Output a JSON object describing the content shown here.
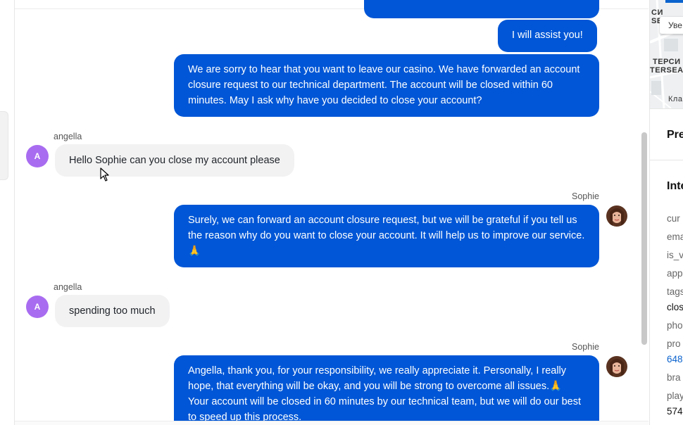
{
  "messages": {
    "m1": {
      "text": "I will assist you!"
    },
    "m2": {
      "text": "We are sorry to hear that you want to leave our casino. We have forwarded an account closure request to our technical department. The account will be closed within 60 minutes. May I ask why have you decided to close your account?"
    },
    "m3": {
      "sender": "angella",
      "avatar": "A",
      "text": "Hello Sophie can you close my account please"
    },
    "m4": {
      "sender": "Sophie",
      "text": "Surely, we can forward an account closure request, but we will be grateful if you tell us the reason why do you want to close your account. It will help us to improve our service.🙏"
    },
    "m5": {
      "sender": "angella",
      "avatar": "A",
      "text": "spending too much"
    },
    "m6": {
      "sender": "Sophie",
      "text": "Angella, thank you, for your responsibility, we really appreciate it. Personally, I really hope, that everything will be okay, and you will be strong to overcome all issues.🙏 Your account will be closed in 60 minutes by our technical team, but we will do our best to speed up this process."
    }
  },
  "right_panel": {
    "map": {
      "zoom_button": "Уве",
      "label1": "СИ",
      "label2": "SE",
      "label3": "ТЕРСИ",
      "label4": "TERSEA",
      "label5": "Кла"
    },
    "section1_title": "Pre",
    "section2_title": "Inte",
    "fields": {
      "k1": "cur",
      "k2": "ema",
      "k3": "is_v",
      "k4": "app",
      "k5": "tags",
      "v5": "clos",
      "k6": "pho",
      "k7": "pro",
      "v7": "648",
      "k8": "bra",
      "k9": "play",
      "v9": "574"
    }
  },
  "colors": {
    "outgoing": "#0056d6",
    "incoming": "#f2f2f3",
    "avatar": "#a86cf0"
  }
}
